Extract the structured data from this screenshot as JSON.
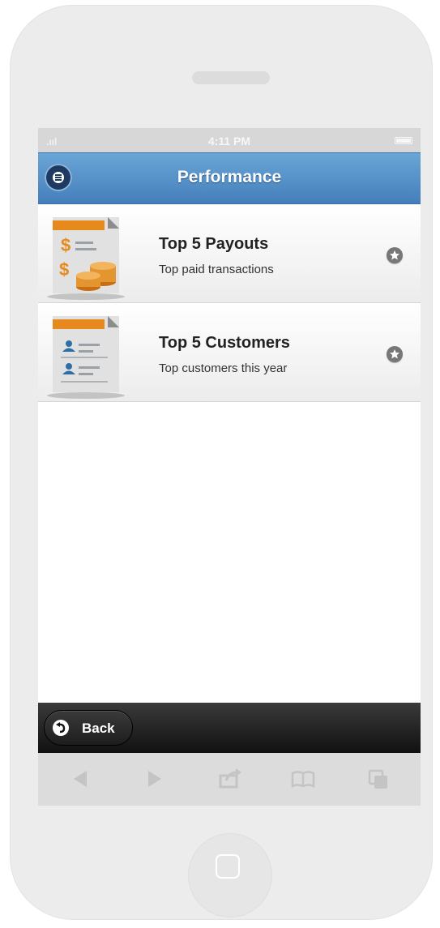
{
  "statusbar": {
    "signal": ".ııl",
    "time": "4:11 PM"
  },
  "header": {
    "title": "Performance",
    "menu_icon": "menu-icon"
  },
  "list": {
    "items": [
      {
        "title": "Top 5 Payouts",
        "subtitle": "Top paid transactions",
        "icon": "payouts-document-icon",
        "action_icon": "star-icon"
      },
      {
        "title": "Top 5 Customers",
        "subtitle": "Top customers this year",
        "icon": "customers-document-icon",
        "action_icon": "star-icon"
      }
    ]
  },
  "footer": {
    "back_label": "Back",
    "back_icon": "back-arrow-icon"
  },
  "browser_toolbar": {
    "icons": [
      "back-arrow-icon",
      "forward-arrow-icon",
      "share-icon",
      "bookmarks-icon",
      "tabs-icon"
    ]
  },
  "colors": {
    "header_top": "#6aa5d6",
    "header_bottom": "#447fbb",
    "footer": "#1a1a1a",
    "document_orange": "#e78a1d",
    "phone_frame": "#ececec"
  }
}
